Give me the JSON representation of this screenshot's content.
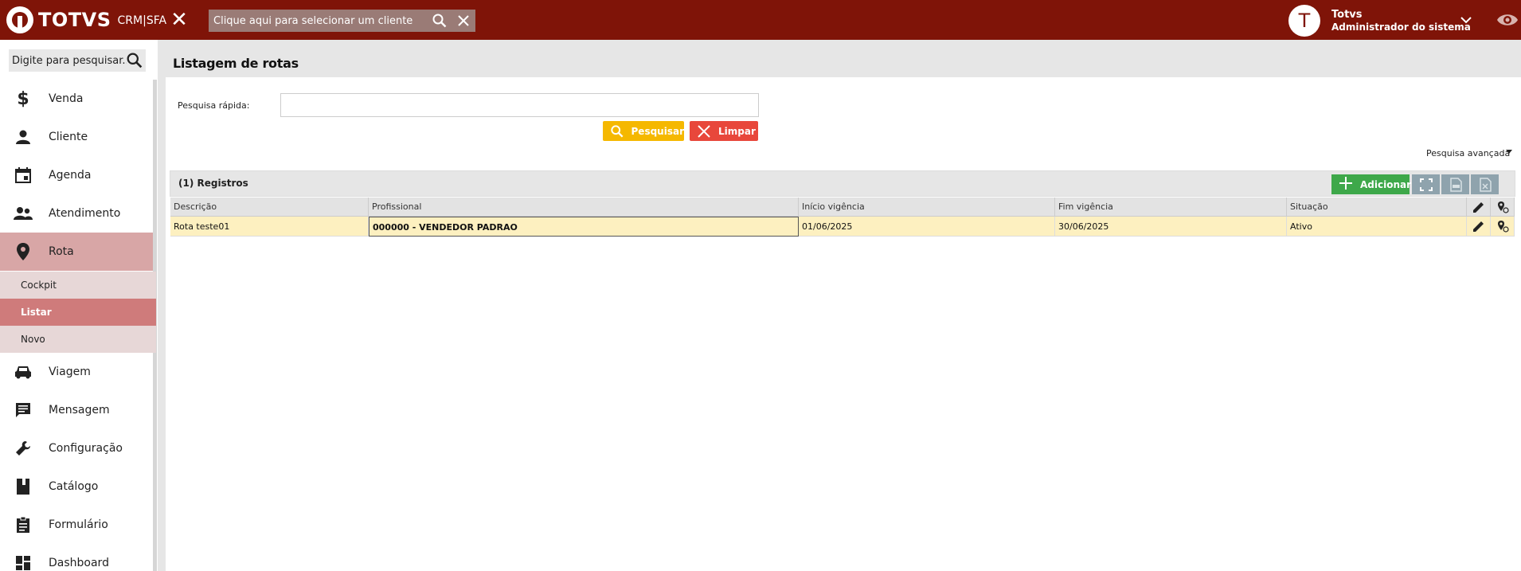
{
  "header": {
    "logo_text": "TOTVS",
    "logo_sub": "CRM|SFA",
    "client_search_placeholder": "Clique aqui para selecionar um cliente",
    "avatar_letter": "T",
    "user_name": "Totvs",
    "user_role": "Administrador do sistema"
  },
  "sidebar": {
    "search_placeholder": "Digite para pesquisar...",
    "items": [
      {
        "label": "Venda",
        "icon": "dollar-icon"
      },
      {
        "label": "Cliente",
        "icon": "person-icon"
      },
      {
        "label": "Agenda",
        "icon": "calendar-icon"
      },
      {
        "label": "Atendimento",
        "icon": "people-icon"
      },
      {
        "label": "Rota",
        "icon": "location-pin-icon",
        "active": true
      },
      {
        "label": "Viagem",
        "icon": "car-icon"
      },
      {
        "label": "Mensagem",
        "icon": "message-icon"
      },
      {
        "label": "Configuração",
        "icon": "wrench-icon"
      },
      {
        "label": "Catálogo",
        "icon": "book-icon"
      },
      {
        "label": "Formulário",
        "icon": "clipboard-icon"
      },
      {
        "label": "Dashboard",
        "icon": "dashboard-icon"
      }
    ],
    "subitems": [
      {
        "label": "Cockpit"
      },
      {
        "label": "Listar",
        "active": true
      },
      {
        "label": "Novo"
      }
    ]
  },
  "page": {
    "title": "Listagem de rotas",
    "quick_search_label": "Pesquisa rápida:",
    "quick_search_value": "",
    "search_button": "Pesquisar",
    "clear_button": "Limpar",
    "advanced_search": "Pesquisa avançada"
  },
  "grid": {
    "count_label": "(1) Registros",
    "add_button": "Adicionar",
    "columns": [
      "Descrição",
      "Profissional",
      "Início vigência",
      "Fim vigência",
      "Situação"
    ],
    "rows": [
      {
        "descricao": "Rota teste01",
        "profissional": "000000 - VENDEDOR PADRAO",
        "inicio": "01/06/2025",
        "fim": "30/06/2025",
        "situacao": "Ativo"
      }
    ]
  },
  "colors": {
    "topbar": "#7f1408",
    "active_menu": "#d8a6a6",
    "active_sub": "#cf7b7b",
    "search_btn": "#f5b800",
    "clear_btn": "#e8473b",
    "add_btn": "#3ea84a",
    "selected_row": "#fdf0c0"
  }
}
